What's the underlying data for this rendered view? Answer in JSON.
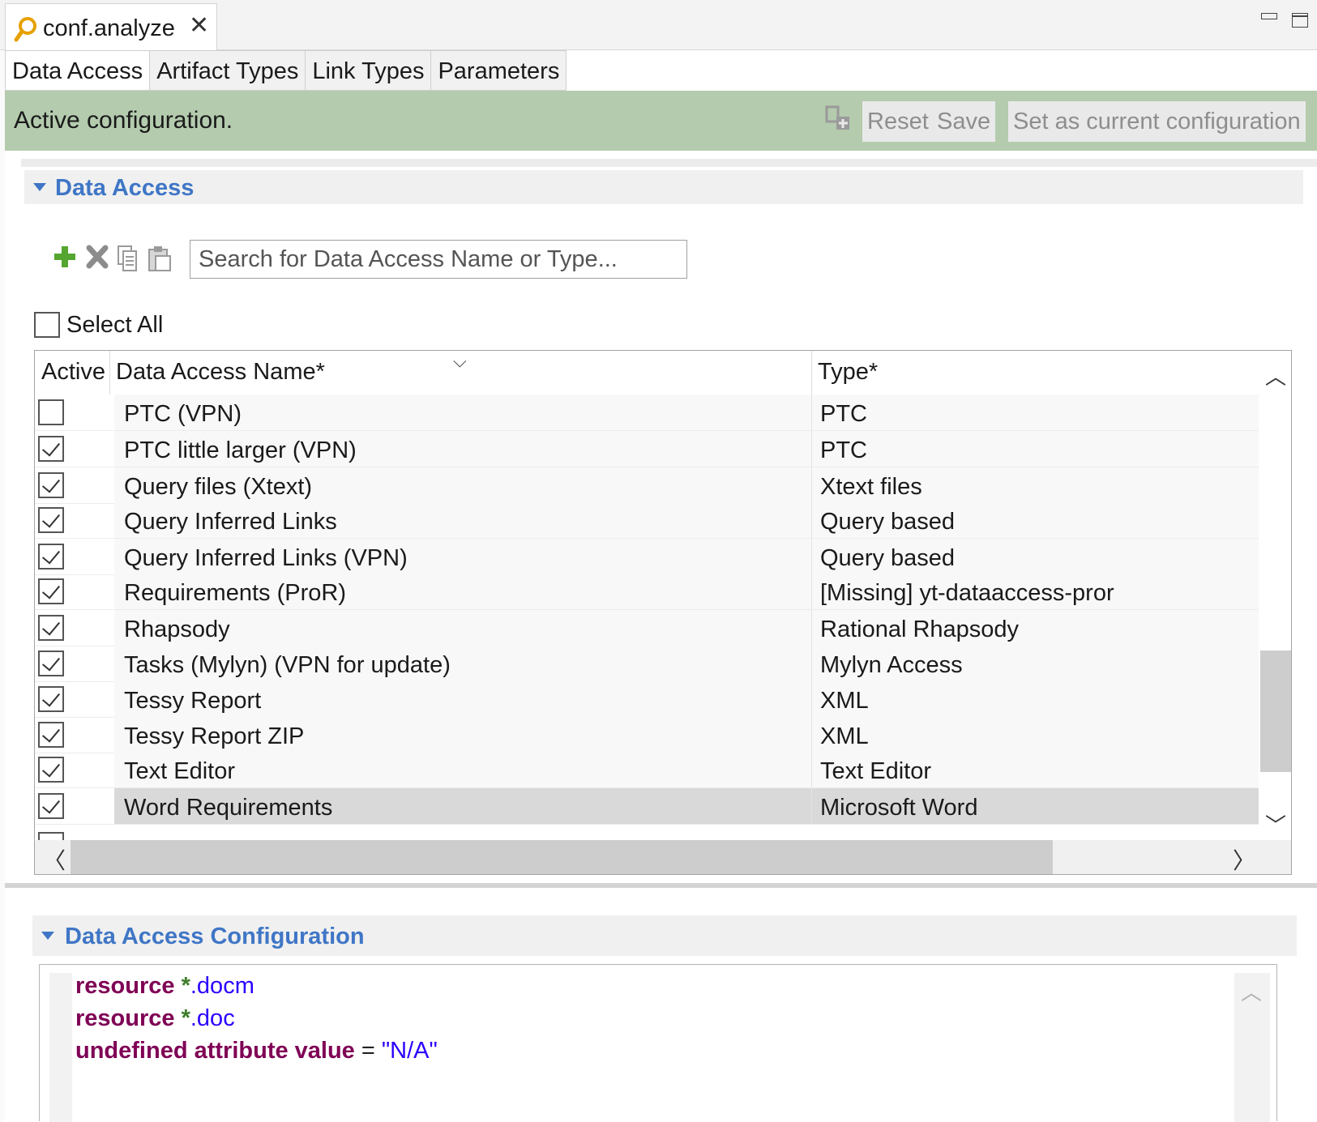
{
  "editor_tab": {
    "title": "conf.analyze",
    "close": "✕"
  },
  "page_tabs": [
    "Data Access",
    "Artifact Types",
    "Link Types",
    "Parameters"
  ],
  "message_bar": {
    "text": "Active configuration.",
    "reset_label": "Reset",
    "save_label": "Save",
    "set_current_label": "Set as current configuration"
  },
  "data_access_section": {
    "title": "Data Access",
    "search_placeholder": "Search for Data Access Name or Type...",
    "select_all_label": "Select All",
    "columns": {
      "active": "Active",
      "name": "Data Access Name*",
      "type": "Type*"
    },
    "rows": [
      {
        "active": false,
        "name": "PTC (VPN)",
        "type": "PTC"
      },
      {
        "active": true,
        "name": "PTC little larger (VPN)",
        "type": "PTC"
      },
      {
        "active": true,
        "name": "Query files (Xtext)",
        "type": "Xtext files"
      },
      {
        "active": true,
        "name": "Query Inferred Links",
        "type": "Query based"
      },
      {
        "active": true,
        "name": "Query Inferred Links (VPN)",
        "type": "Query based"
      },
      {
        "active": true,
        "name": "Requirements (ProR)",
        "type": "[Missing] yt-dataaccess-pror"
      },
      {
        "active": true,
        "name": "Rhapsody",
        "type": "Rational Rhapsody"
      },
      {
        "active": true,
        "name": "Tasks (Mylyn) (VPN for update)",
        "type": "Mylyn Access"
      },
      {
        "active": true,
        "name": "Tessy Report",
        "type": "XML"
      },
      {
        "active": true,
        "name": "Tessy Report ZIP",
        "type": "XML"
      },
      {
        "active": true,
        "name": "Text Editor",
        "type": "Text Editor"
      },
      {
        "active": true,
        "name": "Word Requirements",
        "type": "Microsoft Word",
        "selected": true
      }
    ]
  },
  "config_section": {
    "title": "Data Access Configuration",
    "lines": [
      {
        "kw": "resource",
        "star": "*",
        "ext": ".docm"
      },
      {
        "kw": "resource",
        "star": "*",
        "ext": ".doc"
      },
      {
        "kw": "undefined attribute value",
        "eq": "=",
        "str": "\"N/A\""
      }
    ]
  },
  "colors": {
    "message_bar": "#b4cbae",
    "section_title": "#3f76c6",
    "keyword": "#7f0055",
    "string": "#2a00ff"
  },
  "icons": [
    "analysis-icon",
    "deploy-icon",
    "add-icon",
    "delete-icon",
    "copy-icon",
    "paste-icon",
    "sort-icon"
  ]
}
